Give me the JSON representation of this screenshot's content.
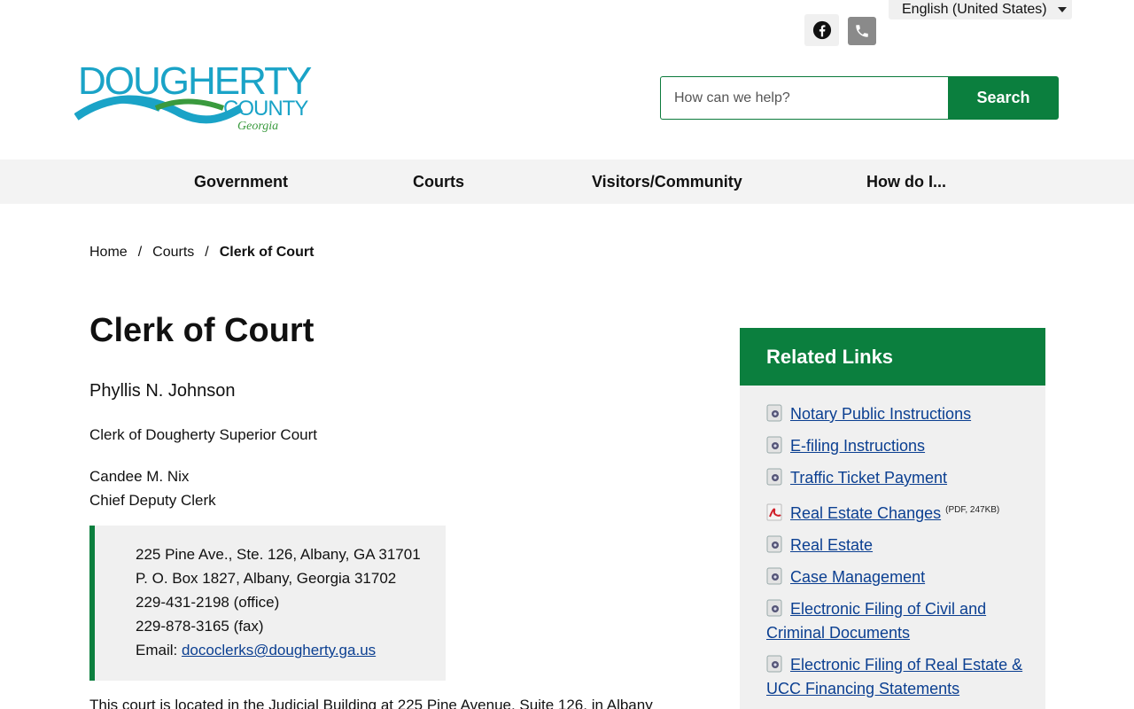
{
  "header": {
    "language": "English (United States)",
    "search_placeholder": "How can we help?",
    "search_button": "Search",
    "logo": {
      "line1": "DOUGHERTY",
      "line2": "COUNTY",
      "line3": "Georgia"
    }
  },
  "nav": {
    "items": [
      "Government",
      "Courts",
      "Visitors/Community",
      "How do I..."
    ]
  },
  "breadcrumb": {
    "home": "Home",
    "courts": "Courts",
    "current": "Clerk of Court"
  },
  "main": {
    "title": "Clerk of Court",
    "name": "Phyllis N. Johnson",
    "role": "Clerk of Dougherty Superior Court",
    "deputy_name": "Candee M. Nix",
    "deputy_role": "Chief Deputy Clerk",
    "address": {
      "line1": "225 Pine Ave., Ste. 126, Albany, GA 31701",
      "line2": "P. O. Box 1827, Albany, Georgia 31702",
      "office": "229-431-2198 (office)",
      "fax": "229-878-3165 (fax)",
      "email_label": "Email: ",
      "email": "dococlerks@dougherty.ga.us"
    },
    "bottom_text": "This court is located in the Judicial Building at 225 Pine Avenue, Suite 126, in Albany"
  },
  "related": {
    "title": "Related Links",
    "links": [
      {
        "label": "Notary Public Instructions",
        "icon": "link-icon"
      },
      {
        "label": "E-filing Instructions",
        "icon": "link-icon"
      },
      {
        "label": "Traffic Ticket Payment",
        "icon": "link-icon"
      },
      {
        "label": "Real Estate Changes",
        "icon": "pdf-icon",
        "meta": "(PDF, 247KB)"
      },
      {
        "label": "Real Estate",
        "icon": "link-icon"
      },
      {
        "label": "Case Management",
        "icon": "link-icon"
      },
      {
        "label": "Electronic Filing of Civil and Criminal Documents",
        "icon": "link-icon"
      },
      {
        "label": "Electronic Filing of Real Estate & UCC Financing Statements",
        "icon": "link-icon"
      }
    ]
  },
  "colors": {
    "accent": "#0b7f3e",
    "link": "#0b3f91"
  }
}
